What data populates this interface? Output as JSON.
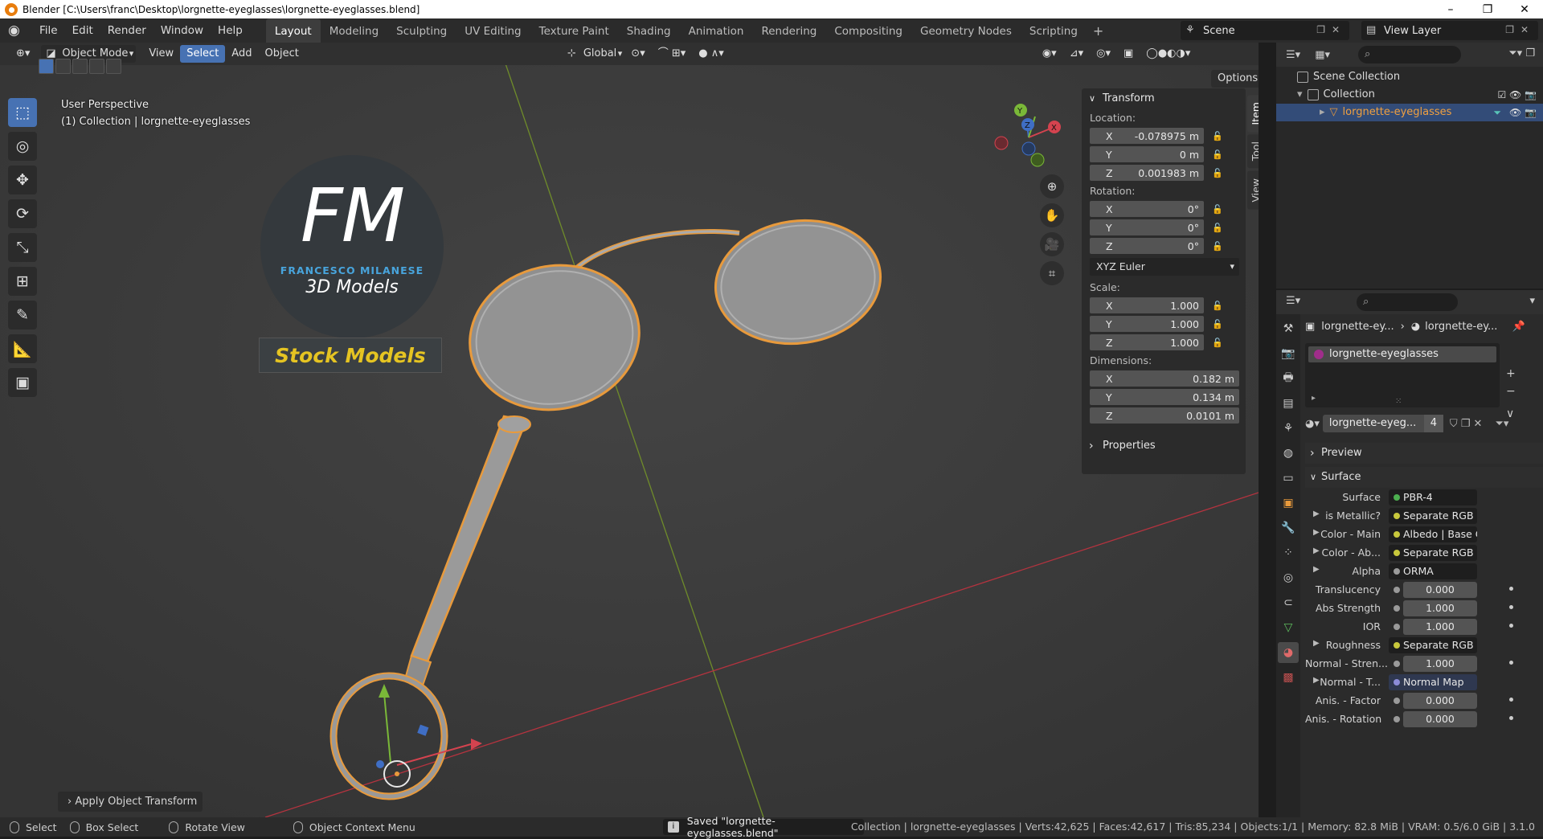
{
  "window": {
    "title": "Blender [C:\\Users\\franc\\Desktop\\lorgnette-eyeglasses\\lorgnette-eyeglasses.blend]",
    "controls": [
      "–",
      "❐",
      "✕"
    ]
  },
  "menu": [
    "File",
    "Edit",
    "Render",
    "Window",
    "Help"
  ],
  "workspaces": [
    "Layout",
    "Modeling",
    "Sculpting",
    "UV Editing",
    "Texture Paint",
    "Shading",
    "Animation",
    "Rendering",
    "Compositing",
    "Geometry Nodes",
    "Scripting"
  ],
  "active_workspace": "Layout",
  "scene": "Scene",
  "view_layer": "View Layer",
  "viewport_header": {
    "mode": "Object Mode",
    "view": "View",
    "select": "Select",
    "add": "Add",
    "object": "Object",
    "orientation": "Global",
    "options": "Options"
  },
  "viewport_info": {
    "line1": "User Perspective",
    "line2": "(1) Collection | lorgnette-eyeglasses"
  },
  "logo": {
    "letters": "FM",
    "name": "FRANCESCO MILANESE",
    "sub": "3D Models",
    "badge": "Stock Models"
  },
  "gizmo": {
    "y": "Y",
    "z": "Z",
    "x": "X"
  },
  "n_panel": {
    "tabs": [
      "Item",
      "Tool",
      "View"
    ],
    "transform_title": "Transform",
    "location_label": "Location:",
    "location": [
      {
        "axis": "X",
        "value": "-0.078975 m"
      },
      {
        "axis": "Y",
        "value": "0 m"
      },
      {
        "axis": "Z",
        "value": "0.001983 m"
      }
    ],
    "rotation_label": "Rotation:",
    "rotation": [
      {
        "axis": "X",
        "value": "0°"
      },
      {
        "axis": "Y",
        "value": "0°"
      },
      {
        "axis": "Z",
        "value": "0°"
      }
    ],
    "rotation_mode": "XYZ Euler",
    "scale_label": "Scale:",
    "scale": [
      {
        "axis": "X",
        "value": "1.000"
      },
      {
        "axis": "Y",
        "value": "1.000"
      },
      {
        "axis": "Z",
        "value": "1.000"
      }
    ],
    "dimensions_label": "Dimensions:",
    "dimensions": [
      {
        "axis": "X",
        "value": "0.182 m"
      },
      {
        "axis": "Y",
        "value": "0.134 m"
      },
      {
        "axis": "Z",
        "value": "0.0101 m"
      }
    ],
    "properties_title": "Properties"
  },
  "redo_panel": "Apply Object Transform",
  "outliner": {
    "scene_collection": "Scene Collection",
    "collection": "Collection",
    "object": "lorgnette-eyeglasses"
  },
  "properties": {
    "crumb_object": "lorgnette-ey...",
    "crumb_material": "lorgnette-ey...",
    "material_slot": "lorgnette-eyeglasses",
    "material_name": "lorgnette-eyeg...",
    "material_users": "4",
    "preview": "Preview",
    "surface_section": "Surface",
    "surface_rows": [
      {
        "label": "Surface",
        "value": "PBR-4",
        "color": "#4caf50",
        "type": "link"
      },
      {
        "label": "is Metallic?",
        "value": "Separate RGB",
        "color": "#c8c83c",
        "type": "link",
        "arrow": true
      },
      {
        "label": "Color - Main",
        "value": "Albedo | Base Color",
        "color": "#c8c83c",
        "type": "link",
        "arrow": true
      },
      {
        "label": "Color - Ab...",
        "value": "Separate RGB",
        "color": "#c8c83c",
        "type": "link",
        "arrow": true
      },
      {
        "label": "Alpha",
        "value": "ORMA",
        "color": "#9a9a9a",
        "type": "link",
        "arrow": true
      },
      {
        "label": "Translucency",
        "value": "0.000",
        "color": "#9a9a9a",
        "type": "num"
      },
      {
        "label": "Abs Strength",
        "value": "1.000",
        "color": "#9a9a9a",
        "type": "num"
      },
      {
        "label": "IOR",
        "value": "1.000",
        "color": "#9a9a9a",
        "type": "num"
      },
      {
        "label": "Roughness",
        "value": "Separate RGB",
        "color": "#c8c83c",
        "type": "link",
        "arrow": true
      },
      {
        "label": "Normal - Stren...",
        "value": "1.000",
        "color": "#9a9a9a",
        "type": "num"
      },
      {
        "label": "Normal - T...",
        "value": "Normal Map",
        "color": "#8c8cd8",
        "type": "link",
        "arrow": true,
        "hl": true
      },
      {
        "label": "Anis. - Factor",
        "value": "0.000",
        "color": "#9a9a9a",
        "type": "num"
      },
      {
        "label": "Anis. - Rotation",
        "value": "0.000",
        "color": "#9a9a9a",
        "type": "num"
      }
    ]
  },
  "statusbar": {
    "select": "Select",
    "box_select": "Box Select",
    "rotate_view": "Rotate View",
    "context_menu": "Object Context Menu",
    "message": "Saved \"lorgnette-eyeglasses.blend\"",
    "stats": "Collection | lorgnette-eyeglasses | Verts:42,625 | Faces:42,617 | Tris:85,234 | Objects:1/1 | Memory: 82.8 MiB | VRAM: 0.5/6.0 GiB | 3.1.0"
  }
}
